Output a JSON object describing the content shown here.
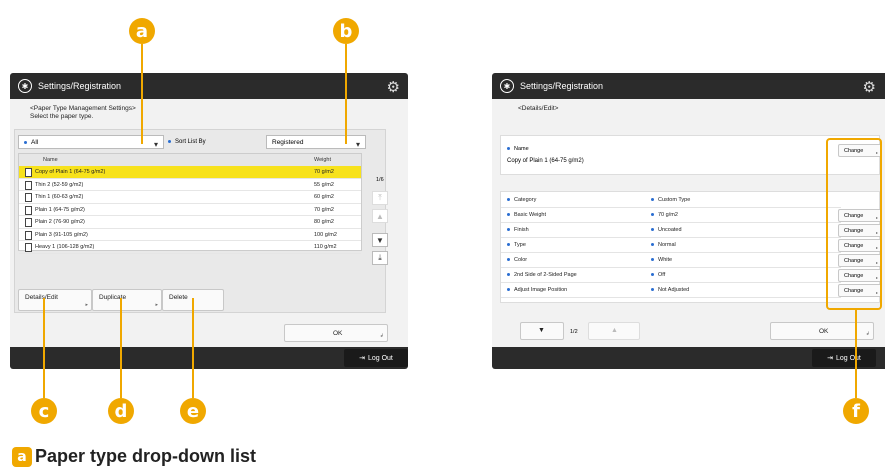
{
  "callouts": {
    "a": "a",
    "b": "b",
    "c": "c",
    "d": "d",
    "e": "e",
    "f": "f"
  },
  "left_screen": {
    "title": "Settings/Registration",
    "breadcrumb": "<Paper Type Management Settings>",
    "instruction": "Select the paper type.",
    "filter_dropdown": "All",
    "sort_label": "Sort List By",
    "sort_dropdown": "Registered",
    "columns": {
      "name": "Name",
      "weight": "Weight"
    },
    "rows": [
      {
        "name": "Copy of Plain 1 (64-75 g/m2)",
        "weight": "70  g/m2"
      },
      {
        "name": "Thin 2 (52-59 g/m2)",
        "weight": "55  g/m2"
      },
      {
        "name": "Thin 1 (60-63 g/m2)",
        "weight": "60  g/m2"
      },
      {
        "name": "Plain 1 (64-75 g/m2)",
        "weight": "70  g/m2"
      },
      {
        "name": "Plain 2 (76-90 g/m2)",
        "weight": "80  g/m2"
      },
      {
        "name": "Plain 3 (91-105 g/m2)",
        "weight": "100 g/m2"
      },
      {
        "name": "Heavy 1 (106-128 g/m2)",
        "weight": "110 g/m2"
      }
    ],
    "page_indicator": "1/6",
    "buttons": {
      "details_edit": "Details/Edit",
      "duplicate": "Duplicate",
      "delete": "Delete",
      "ok": "OK"
    },
    "logout": "Log Out"
  },
  "right_screen": {
    "title": "Settings/Registration",
    "breadcrumb": "<Details/Edit>",
    "name_label": "Name",
    "name_value": "Copy of Plain 1 (64-75 g/m2)",
    "change_label": "Change",
    "details": [
      {
        "key": "Category",
        "value": "Custom Type"
      },
      {
        "key": "Basic Weight",
        "value": "70 g/m2"
      },
      {
        "key": "Finish",
        "value": "Uncoated"
      },
      {
        "key": "Type",
        "value": "Normal"
      },
      {
        "key": "Color",
        "value": "White"
      },
      {
        "key": "2nd Side of 2-Sided Page",
        "value": "Off"
      },
      {
        "key": "Adjust Image Position",
        "value": "Not Adjusted"
      }
    ],
    "page_indicator": "1/2",
    "ok": "OK",
    "logout": "Log Out"
  },
  "caption": {
    "letter": "a",
    "text": "Paper type drop-down list"
  },
  "colors": {
    "accent": "#f0a800",
    "selected_row": "#f7e21c",
    "title_bar": "#2b2b2b"
  }
}
